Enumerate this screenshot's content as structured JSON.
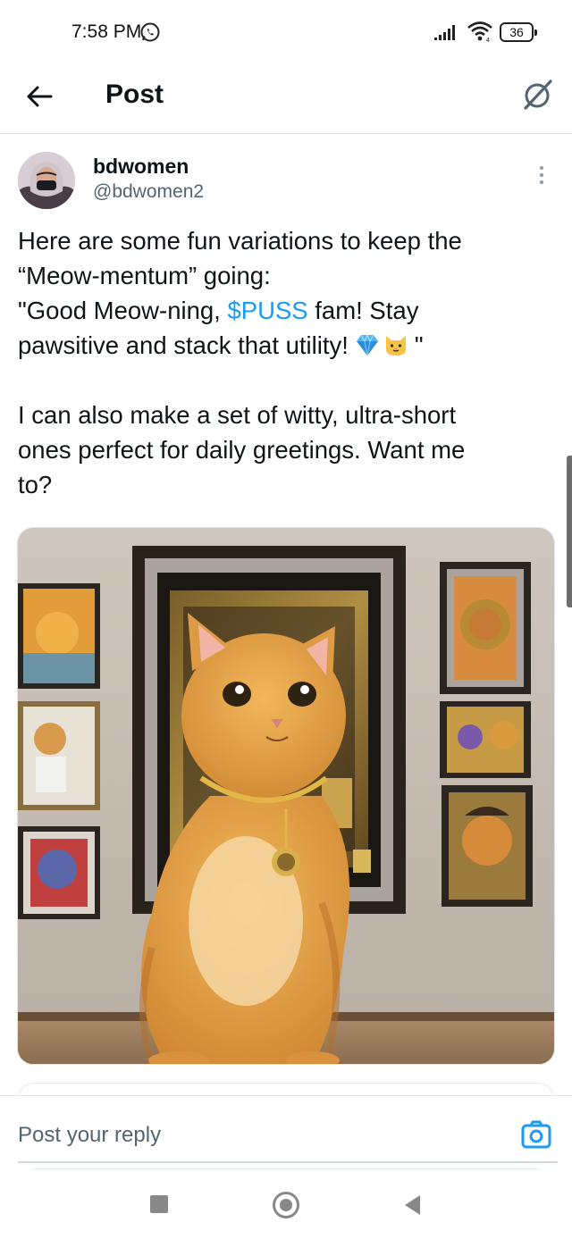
{
  "status_bar": {
    "time": "7:58 PM",
    "battery": "36",
    "icons": [
      "whatsapp-icon",
      "signal-icon",
      "wifi-icon",
      "battery-icon"
    ]
  },
  "header": {
    "title": "Post",
    "back_icon": "arrow-left-icon",
    "grok_icon": "grok-icon"
  },
  "post": {
    "author_name": "bdwomen",
    "author_handle": "@bdwomen2",
    "lines": [
      "Here are some fun variations to keep the",
      "“Meow-mentum” going:",
      "\"Good Meow-ning, ",
      " fam! Stay",
      "pawsitive and stack that utility!",
      "\"",
      "I can also make a set of witty, ultra-short",
      "ones perfect for daily greetings. Want me",
      "to?"
    ],
    "cashtag": "$PUSS",
    "emoji": [
      "gem-emoji",
      "cat-face-emoji"
    ],
    "image_description_icon": "cat-gallery-image"
  },
  "reply": {
    "placeholder": "Post your reply",
    "camera_icon": "camera-icon"
  },
  "colors": {
    "link": "#1d9bf0",
    "text": "#0f1419",
    "secondary": "#536471"
  }
}
